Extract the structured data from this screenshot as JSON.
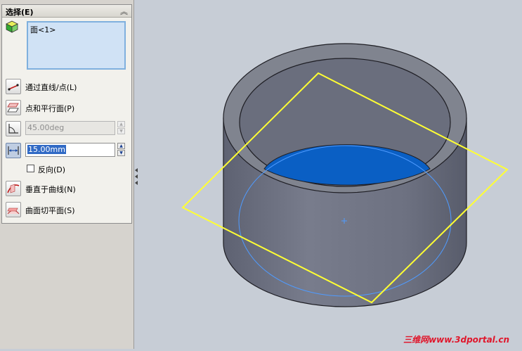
{
  "panel": {
    "group_title": "选择(E)",
    "collapse_glyph": "︽",
    "selection_item": "面<1>",
    "options": {
      "through_line": "通过直线/点(L)",
      "point_parallel": "点和平行面(P)",
      "angle_value": "45.00deg",
      "distance_value": "15.00mm",
      "reverse_label": "反向(D)",
      "normal_to_curve": "垂直于曲线(N)",
      "tangent_surface": "曲面切平面(S)"
    },
    "icons": [
      "cube-icon",
      "line-point-icon",
      "parallel-plane-icon",
      "angle-icon",
      "distance-icon",
      "normal-curve-icon",
      "tangent-surface-icon"
    ],
    "reverse_checked": false
  },
  "viewport": {
    "watermark": "三维网www.3dportal.cn",
    "colors": {
      "background": "#c7cdd6",
      "body": "#6f7382",
      "face_highlight": "#0a5fc4",
      "plane_preview": "#ffff33",
      "edge_preview": "#4f9bff"
    }
  }
}
